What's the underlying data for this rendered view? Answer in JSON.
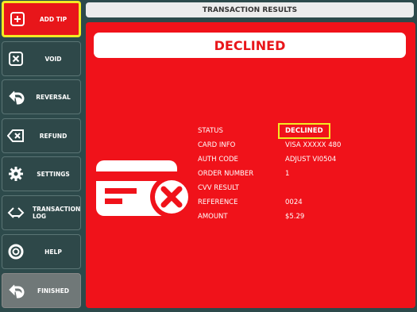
{
  "sidebar": {
    "items": [
      {
        "label": "ADD TIP",
        "icon": "plus-box-icon"
      },
      {
        "label": "VOID",
        "icon": "x-box-icon"
      },
      {
        "label": "REVERSAL",
        "icon": "undo-arrow-icon"
      },
      {
        "label": "REFUND",
        "icon": "backspace-x-icon"
      },
      {
        "label": "SETTINGS",
        "icon": "gear-icon"
      },
      {
        "label": "TRANSACTION LOG",
        "icon": "code-brackets-icon"
      },
      {
        "label": "HELP",
        "icon": "lifebuoy-icon"
      },
      {
        "label": "FINISHED",
        "icon": "undo-arrow-icon"
      }
    ]
  },
  "header": {
    "title": "TRANSACTION RESULTS"
  },
  "result": {
    "banner": "DECLINED",
    "icon": "declined-card-icon",
    "fields": [
      {
        "label": "STATUS",
        "value": "DECLINED"
      },
      {
        "label": "CARD INFO",
        "value": "VISA XXXXX 480"
      },
      {
        "label": "AUTH CODE",
        "value": "ADJUST VI0504"
      },
      {
        "label": "ORDER NUMBER",
        "value": "1"
      },
      {
        "label": "CVV RESULT",
        "value": ""
      },
      {
        "label": "REFERENCE",
        "value": "0024"
      },
      {
        "label": "AMOUNT",
        "value": "$5.29"
      }
    ]
  },
  "colors": {
    "panel_red": "#f0121a",
    "highlight_yellow": "#f2ea23",
    "sidebar_bg": "#2e4849"
  }
}
